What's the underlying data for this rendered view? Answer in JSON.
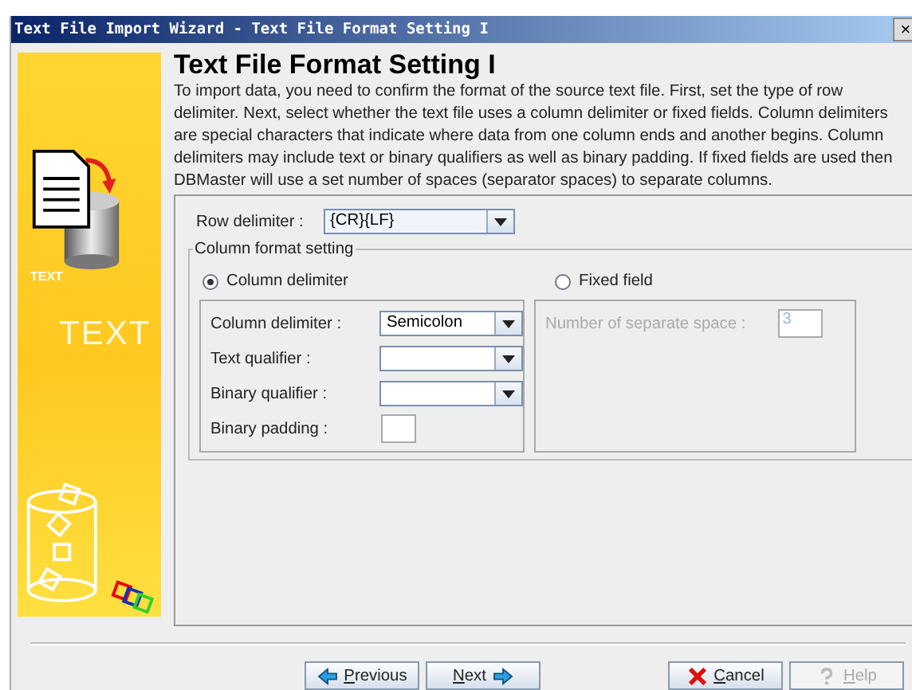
{
  "window": {
    "title": "Text File Import Wizard - Text File Format Setting I",
    "close": "×"
  },
  "banner": {
    "icon_label": "TEXT",
    "big_label": "TEXT"
  },
  "heading": "Text File Format Setting I",
  "description": "To import data, you need to confirm the format of the source text file. First, set the type of row delimiter. Next, select whether the text file uses a column delimiter or fixed fields. Column delimiters are special characters that indicate where data from one column ends and another begins. Column delimiters may include text or binary qualifiers as well as binary padding.  If fixed fields are used then DBMaster will use a set number of spaces (separator spaces) to separate columns.",
  "row_delimiter": {
    "label": "Row delimiter :",
    "value": "{CR}{LF}"
  },
  "column_format": {
    "legend": "Column format setting",
    "modes": [
      {
        "label": "Column delimiter",
        "selected": true
      },
      {
        "label": "Fixed field",
        "selected": false
      }
    ],
    "delimiter_fields": [
      {
        "kind": "combo",
        "label": "Column delimiter :",
        "value": "Semicolon"
      },
      {
        "kind": "combo",
        "label": "Text qualifier :"
      },
      {
        "kind": "combo",
        "label": "Binary qualifier :"
      },
      {
        "kind": "text",
        "label": "Binary padding :"
      }
    ],
    "fixed_field": {
      "label": "Number of separate space :",
      "value": "3",
      "disabled": true
    }
  },
  "buttons": [
    {
      "kind": "previous",
      "label": "Previous",
      "disabled": false
    },
    {
      "kind": "next",
      "label": "Next",
      "disabled": false
    },
    {
      "kind": "cancel",
      "label": "Cancel",
      "disabled": false
    },
    {
      "kind": "help",
      "label": "Help",
      "disabled": true
    }
  ]
}
